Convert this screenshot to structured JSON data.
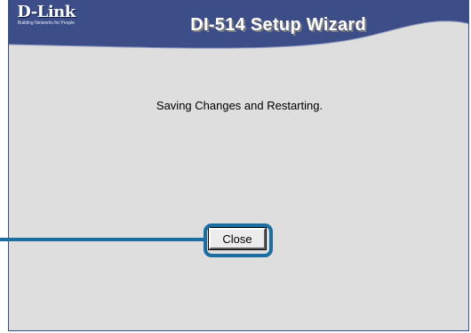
{
  "header": {
    "logo_text": "D-Link",
    "logo_tagline": "Building Networks for People",
    "title": "DI-514 Setup Wizard"
  },
  "main": {
    "status_message": "Saving Changes and Restarting.",
    "close_label": "Close"
  },
  "colors": {
    "header_blue": "#3c4d88",
    "window_bg": "#dedede",
    "callout_blue": "#1b6e9f"
  }
}
